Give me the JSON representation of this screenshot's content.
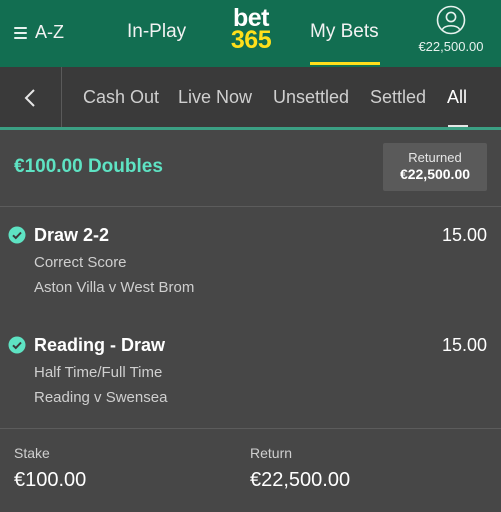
{
  "header": {
    "menu_label": "A-Z",
    "inplay_label": "In-Play",
    "logo_line1": "bet",
    "logo_line2": "365",
    "mybets_label": "My Bets",
    "balance": "€22,500.00"
  },
  "subnav": {
    "tabs": [
      {
        "label": "Cash Out"
      },
      {
        "label": "Live Now"
      },
      {
        "label": "Unsettled"
      },
      {
        "label": "Settled"
      },
      {
        "label": "All"
      }
    ],
    "active_tab": "All"
  },
  "bet": {
    "title": "€100.00 Doubles",
    "returned_label": "Returned",
    "returned_value": "€22,500.00",
    "selections": [
      {
        "name": "Draw 2-2",
        "odds": "15.00",
        "market": "Correct Score",
        "event": "Aston Villa v West Brom",
        "status": "won"
      },
      {
        "name": "Reading - Draw",
        "odds": "15.00",
        "market": "Half Time/Full Time",
        "event": "Reading v Swensea",
        "status": "won"
      }
    ],
    "stake_label": "Stake",
    "stake_value": "€100.00",
    "return_label": "Return",
    "return_value": "€22,500.00"
  },
  "colors": {
    "header_bg": "#126e51",
    "accent_yellow": "#ffdf1b",
    "title_green": "#5ee3c3",
    "check_green": "#5ee3c3",
    "body_bg": "#474747"
  },
  "icons": {
    "menu": "hamburger-icon",
    "account": "user-circle-icon",
    "back": "chevron-left-icon",
    "status": "check-circle-icon"
  }
}
